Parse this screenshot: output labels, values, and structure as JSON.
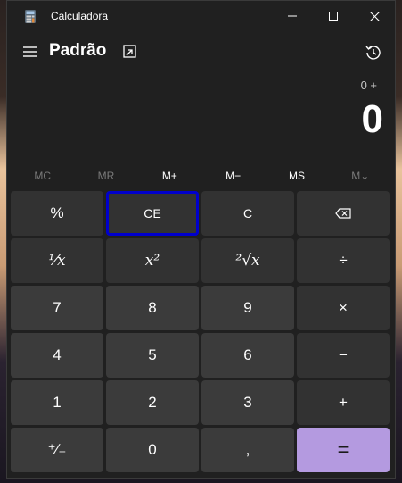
{
  "window": {
    "title": "Calculadora"
  },
  "header": {
    "mode": "Padrão"
  },
  "display": {
    "expression": "0 +",
    "value": "0"
  },
  "memory": {
    "mc": "MC",
    "mr": "MR",
    "mplus": "M+",
    "mminus": "M−",
    "ms": "MS",
    "mlist": "M⌄"
  },
  "keys": {
    "percent": "%",
    "ce": "CE",
    "c": "C",
    "reciprocal": "⅟x",
    "square": "x²",
    "sqrt": "²√x",
    "divide": "÷",
    "seven": "7",
    "eight": "8",
    "nine": "9",
    "multiply": "×",
    "four": "4",
    "five": "5",
    "six": "6",
    "minus": "−",
    "one": "1",
    "two": "2",
    "three": "3",
    "plus": "+",
    "negate": "⁺∕₋",
    "zero": "0",
    "decimal": ",",
    "equals": "="
  },
  "colors": {
    "accent": "#b49ae0",
    "focus_outline": "#0000cc",
    "background": "#202020"
  }
}
